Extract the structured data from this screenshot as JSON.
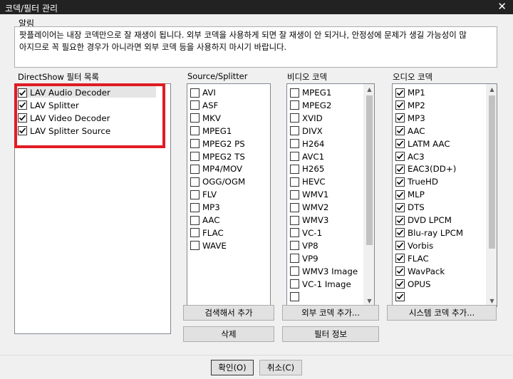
{
  "window": {
    "title": "코덱/필터 관리",
    "close_glyph": "✕"
  },
  "notice": {
    "label": "알림",
    "lines": [
      "팟플레이어는 내장 코덱만으로 잘 재생이 됩니다. 외부 코덱을 사용하게 되면 잘 재생이 안 되거나, 안정성에 문제가 생길 가능성이 많",
      "아지므로 꼭 필요한 경우가 아니라면 외부 코덱 등을 사용하지 마시기 바랍니다."
    ]
  },
  "directshow": {
    "label": "DirectShow 필터 목록",
    "items": [
      {
        "label": "LAV Audio Decoder",
        "checked": true
      },
      {
        "label": "LAV Splitter",
        "checked": true
      },
      {
        "label": "LAV Video Decoder",
        "checked": true
      },
      {
        "label": "LAV Splitter Source",
        "checked": true
      }
    ]
  },
  "source": {
    "label": "Source/Splitter",
    "items": [
      {
        "label": "AVI",
        "checked": false
      },
      {
        "label": "ASF",
        "checked": false
      },
      {
        "label": "MKV",
        "checked": false
      },
      {
        "label": "MPEG1",
        "checked": false
      },
      {
        "label": "MPEG2 PS",
        "checked": false
      },
      {
        "label": "MPEG2 TS",
        "checked": false
      },
      {
        "label": "MP4/MOV",
        "checked": false
      },
      {
        "label": "OGG/OGM",
        "checked": false
      },
      {
        "label": "FLV",
        "checked": false
      },
      {
        "label": "MP3",
        "checked": false
      },
      {
        "label": "AAC",
        "checked": false
      },
      {
        "label": "FLAC",
        "checked": false
      },
      {
        "label": "WAVE",
        "checked": false
      }
    ]
  },
  "video": {
    "label": "비디오 코덱",
    "items": [
      {
        "label": "MPEG1",
        "checked": false
      },
      {
        "label": "MPEG2",
        "checked": false
      },
      {
        "label": "XVID",
        "checked": false
      },
      {
        "label": "DIVX",
        "checked": false
      },
      {
        "label": "H264",
        "checked": false
      },
      {
        "label": "AVC1",
        "checked": false
      },
      {
        "label": "H265",
        "checked": false
      },
      {
        "label": "HEVC",
        "checked": false
      },
      {
        "label": "WMV1",
        "checked": false
      },
      {
        "label": "WMV2",
        "checked": false
      },
      {
        "label": "WMV3",
        "checked": false
      },
      {
        "label": "VC-1",
        "checked": false
      },
      {
        "label": "VP8",
        "checked": false
      },
      {
        "label": "VP9",
        "checked": false
      },
      {
        "label": "WMV3 Image",
        "checked": false
      },
      {
        "label": "VC-1 Image",
        "checked": false
      },
      {
        "label": "",
        "checked": false
      }
    ]
  },
  "audio": {
    "label": "오디오 코덱",
    "items": [
      {
        "label": "MP1",
        "checked": true
      },
      {
        "label": "MP2",
        "checked": true
      },
      {
        "label": "MP3",
        "checked": true
      },
      {
        "label": "AAC",
        "checked": true
      },
      {
        "label": "LATM AAC",
        "checked": true
      },
      {
        "label": "AC3",
        "checked": true
      },
      {
        "label": "EAC3(DD+)",
        "checked": true
      },
      {
        "label": "TrueHD",
        "checked": true
      },
      {
        "label": "MLP",
        "checked": true
      },
      {
        "label": "DTS",
        "checked": true
      },
      {
        "label": "DVD LPCM",
        "checked": true
      },
      {
        "label": "Blu-ray LPCM",
        "checked": true
      },
      {
        "label": "Vorbis",
        "checked": true
      },
      {
        "label": "FLAC",
        "checked": true
      },
      {
        "label": "WavPack",
        "checked": true
      },
      {
        "label": "OPUS",
        "checked": true
      },
      {
        "label": "",
        "checked": true
      }
    ]
  },
  "buttons": {
    "search_add": "검색해서 추가",
    "delete": "삭제",
    "external_add": "외부 코덱 추가...",
    "filter_info": "필터 정보",
    "system_add": "시스템 코덱 추가...",
    "ok": "확인(O)",
    "cancel": "취소(C)"
  },
  "colors": {
    "highlight": "#e01b24",
    "titlebar": "#222222"
  },
  "icons": {
    "checkbox_checked": "check-icon",
    "close": "close-icon",
    "scroll_up": "scroll-up-icon",
    "scroll_down": "scroll-down-icon"
  }
}
